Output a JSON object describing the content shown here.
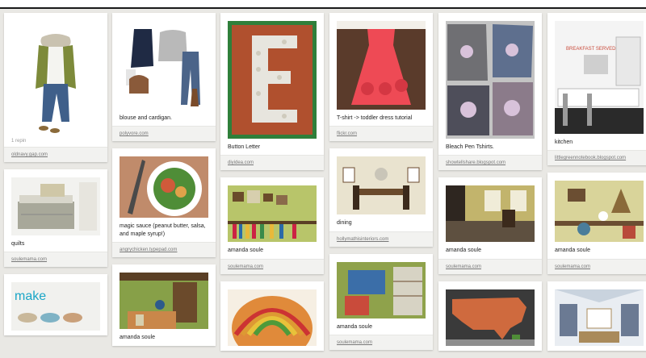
{
  "columns": [
    {
      "pins": [
        {
          "desc": "",
          "repin": "1 repin",
          "source": "oldnavy.gap.com",
          "thumb": "outfit"
        },
        {
          "desc": "quilts",
          "repin": "",
          "source": "soulemama.com",
          "thumb": "quilts"
        },
        {
          "desc": "",
          "repin": "",
          "source": "",
          "thumb": "make"
        }
      ]
    },
    {
      "pins": [
        {
          "desc": "blouse and cardigan.",
          "repin": "",
          "source": "polyvore.com",
          "thumb": "cardigan"
        },
        {
          "desc": "magic sauce (peanut butter, salsa, and maple syrup!)",
          "repin": "",
          "source": "angrychicken.typepad.com",
          "thumb": "salad"
        },
        {
          "desc": "amanda soule",
          "repin": "",
          "source": "",
          "thumb": "greenroom"
        }
      ]
    },
    {
      "pins": [
        {
          "desc": "Button Letter",
          "repin": "",
          "source": "diyidea.com",
          "thumb": "button"
        },
        {
          "desc": "amanda soule",
          "repin": "",
          "source": "soulemama.com",
          "thumb": "shelf"
        },
        {
          "desc": "",
          "repin": "",
          "source": "",
          "thumb": "rainbow"
        }
      ]
    },
    {
      "pins": [
        {
          "desc": "T-shirt -> toddler dress tutorial",
          "repin": "",
          "source": "flickr.com",
          "thumb": "dress"
        },
        {
          "desc": "dining",
          "repin": "",
          "source": "hollymathisinteriors.com",
          "thumb": "dining"
        },
        {
          "desc": "amanda soule",
          "repin": "",
          "source": "soulemama.com",
          "thumb": "classroom"
        }
      ]
    },
    {
      "pins": [
        {
          "desc": "Bleach Pen Tshirts.",
          "repin": "",
          "source": "showtellshare.blogspot.com",
          "thumb": "tshirts"
        },
        {
          "desc": "amanda soule",
          "repin": "",
          "source": "soulemama.com",
          "thumb": "woodroom"
        },
        {
          "desc": "",
          "repin": "",
          "source": "",
          "thumb": "usmap"
        }
      ]
    },
    {
      "pins": [
        {
          "desc": "kitchen",
          "repin": "",
          "source": "littlegreennotebook.blogspot.com",
          "thumb": "kitchen"
        },
        {
          "desc": "amanda soule",
          "repin": "",
          "source": "soulemama.com",
          "thumb": "shelfdecor"
        },
        {
          "desc": "",
          "repin": "",
          "source": "",
          "thumb": "livingroom"
        }
      ]
    }
  ],
  "thumbs": {
    "outfit": {
      "bg": "#ffffff",
      "accent": "#7d8a3a",
      "accent2": "#3f5f8a"
    },
    "quilts": {
      "bg": "#f2f2ef",
      "accent": "#a8a89a",
      "accent2": "#cfc7a7"
    },
    "make": {
      "bg": "#f1f1ee",
      "accent": "#1aa6c7",
      "accent2": "#c9b89a",
      "text": "make"
    },
    "cardigan": {
      "bg": "#ffffff",
      "accent": "#1f2a44",
      "accent2": "#b9b9b9"
    },
    "salad": {
      "bg": "#c08b6b",
      "accent": "#4f8d37",
      "accent2": "#ffffff"
    },
    "greenroom": {
      "bg": "#87a048",
      "accent": "#6b4a2b",
      "accent2": "#d7cfae"
    },
    "button": {
      "bg": "#b0502e",
      "accent": "#e7e5de",
      "accent2": "#2f7f3a"
    },
    "shelf": {
      "bg": "#b8c56a",
      "accent": "#6a4b2a",
      "accent2": "#c24"
    },
    "rainbow": {
      "bg": "#f6efe3",
      "accent": "#d93",
      "accent2": "#c33"
    },
    "dress": {
      "bg": "#5a3b2b",
      "accent": "#ee4a55",
      "accent2": "#d43743"
    },
    "dining": {
      "bg": "#e9e3cf",
      "accent": "#6a4a2c",
      "accent2": "#c9c5b8"
    },
    "classroom": {
      "bg": "#d7d3c4",
      "accent": "#3b6ea8",
      "accent2": "#8fa24b"
    },
    "tshirts": {
      "bg": "#c3c3c3",
      "accent": "#4e4e5a",
      "accent2": "#a38aa9"
    },
    "woodroom": {
      "bg": "#5e5040",
      "accent": "#c2b46c",
      "accent2": "#2e2620"
    },
    "usmap": {
      "bg": "#3a3a3a",
      "accent": "#cf6a3e",
      "accent2": "#8e8e8e"
    },
    "kitchen": {
      "bg": "#f4f4f4",
      "accent": "#2a2a2a",
      "accent2": "#c94b3b",
      "text": "BREAKFAST SERVED"
    },
    "shelfdecor": {
      "bg": "#d9d49a",
      "accent": "#6b4e32",
      "accent2": "#4a7d9a"
    },
    "livingroom": {
      "bg": "#e9edf2",
      "accent": "#6b7a93",
      "accent2": "#a98a5b"
    }
  }
}
